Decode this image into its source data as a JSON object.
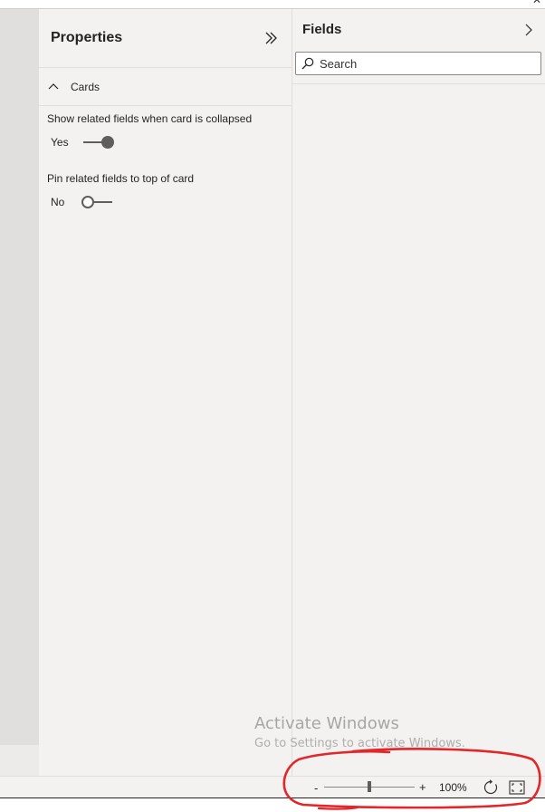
{
  "window": {
    "close_glyph": "✕"
  },
  "properties": {
    "title": "Properties",
    "expand_icon": "double-chevron-right-icon",
    "section": {
      "label": "Cards",
      "expanded": true
    },
    "settings": [
      {
        "label": "Show related fields when card is collapsed",
        "state_label": "Yes",
        "on": true
      },
      {
        "label": "Pin related fields to top of card",
        "state_label": "No",
        "on": false
      }
    ]
  },
  "fields": {
    "title": "Fields",
    "search": {
      "placeholder": "Search",
      "value": ""
    }
  },
  "watermark": {
    "title": "Activate Windows",
    "subtitle": "Go to Settings to activate Windows."
  },
  "zoom": {
    "minus": "-",
    "plus": "+",
    "level": "100%",
    "slider_fraction": 0.5
  },
  "colors": {
    "panel_bg": "#f3f2f1",
    "annotation": "#e3262a",
    "toggle": "#605e5c"
  }
}
